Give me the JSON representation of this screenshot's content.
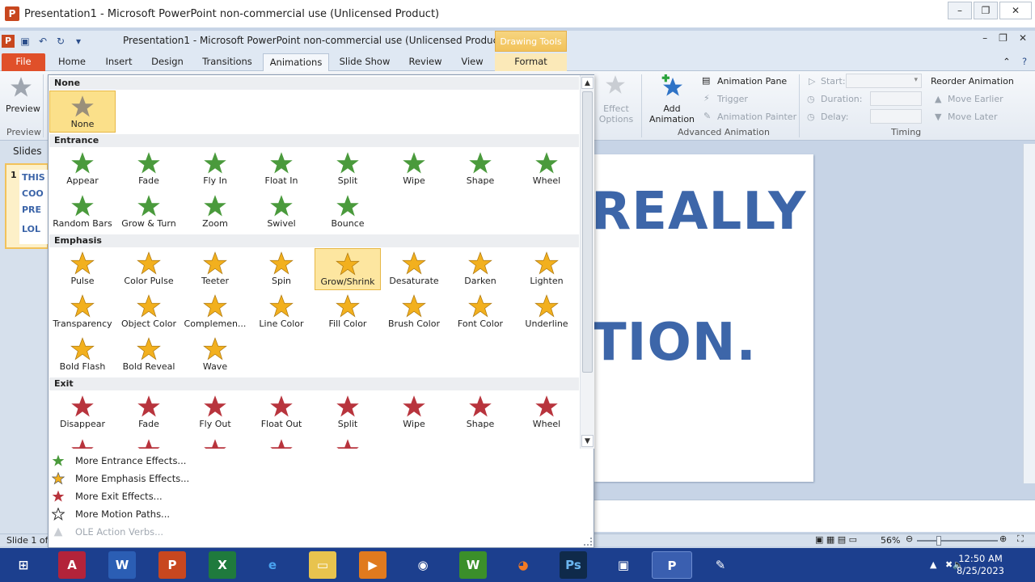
{
  "window": {
    "outer_title": "Presentation1 - Microsoft PowerPoint non-commercial use (Unlicensed Product)",
    "inner_title": "Presentation1  -  Microsoft PowerPoint non-commercial use (Unlicensed Product)",
    "contextual_tab_group": "Drawing Tools"
  },
  "tabs": [
    "File",
    "Home",
    "Insert",
    "Design",
    "Transitions",
    "Animations",
    "Slide Show",
    "Review",
    "View",
    "Format"
  ],
  "ribbon": {
    "preview": "Preview",
    "preview_group": "Preview",
    "effect_options": "Effect Options",
    "add_animation": "Add Animation",
    "animation_pane": "Animation Pane",
    "trigger": "Trigger",
    "animation_painter": "Animation Painter",
    "advanced_group": "Advanced Animation",
    "start": "Start:",
    "duration": "Duration:",
    "delay": "Delay:",
    "timing_group": "Timing",
    "reorder": "Reorder Animation",
    "move_earlier": "Move Earlier",
    "move_later": "Move Later"
  },
  "slides_pane": {
    "label": "Slides",
    "slide_number": "1",
    "thumb_lines": [
      "THIS",
      "COO",
      "PRE",
      "LOL"
    ]
  },
  "slide": {
    "line1": "REALLY",
    "line2": "TION."
  },
  "gallery": {
    "none_header": "None",
    "none_label": "None",
    "entrance_header": "Entrance",
    "entrance": [
      "Appear",
      "Fade",
      "Fly In",
      "Float In",
      "Split",
      "Wipe",
      "Shape",
      "Wheel",
      "Random Bars",
      "Grow & Turn",
      "Zoom",
      "Swivel",
      "Bounce"
    ],
    "emphasis_header": "Emphasis",
    "emphasis": [
      "Pulse",
      "Color Pulse",
      "Teeter",
      "Spin",
      "Grow/Shrink",
      "Desaturate",
      "Darken",
      "Lighten",
      "Transparency",
      "Object Color",
      "Complemen...",
      "Line Color",
      "Fill Color",
      "Brush Color",
      "Font Color",
      "Underline",
      "Bold Flash",
      "Bold Reveal",
      "Wave"
    ],
    "exit_header": "Exit",
    "exit": [
      "Disappear",
      "Fade",
      "Fly Out",
      "Float Out",
      "Split",
      "Wipe",
      "Shape",
      "Wheel"
    ],
    "more": [
      "More Entrance Effects...",
      "More Emphasis Effects...",
      "More Exit Effects...",
      "More Motion Paths...",
      "OLE Action Verbs..."
    ]
  },
  "status": {
    "slide_info": "Slide 1 of",
    "zoom": "56%"
  },
  "taskbar": {
    "time": "12:50 AM",
    "date": "8/25/2023"
  },
  "colors": {
    "entrance_star": "#4a9a3c",
    "emphasis_star": "#f2b01e",
    "exit_star": "#b8343d",
    "none_star": "#9a8f7a",
    "slide_text": "#3d66a9"
  }
}
